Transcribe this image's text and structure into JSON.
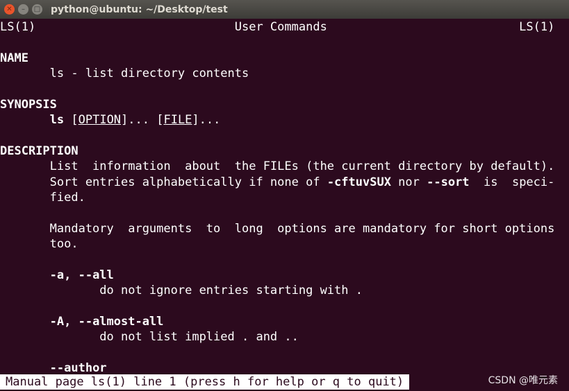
{
  "window": {
    "title": "python@ubuntu: ~/Desktop/test",
    "buttons": [
      "close",
      "minimize",
      "maximize"
    ]
  },
  "colors": {
    "terminal_bg": "#2c0a1e",
    "text": "#ffffff",
    "close_button": "#e9542b"
  },
  "man": {
    "lines": [
      [
        {
          "t": "LS(1)                            User Commands                           LS(1)"
        }
      ],
      [],
      [
        {
          "t": "NAME",
          "s": "b"
        }
      ],
      [
        {
          "t": "       ls - list directory contents"
        }
      ],
      [],
      [
        {
          "t": "SYNOPSIS",
          "s": "b"
        }
      ],
      [
        {
          "t": "       "
        },
        {
          "t": "ls",
          "s": "b"
        },
        {
          "t": " ["
        },
        {
          "t": "OPTION",
          "s": "u"
        },
        {
          "t": "]... ["
        },
        {
          "t": "FILE",
          "s": "u"
        },
        {
          "t": "]..."
        }
      ],
      [],
      [
        {
          "t": "DESCRIPTION",
          "s": "b"
        }
      ],
      [
        {
          "t": "       List  information  about  the FILEs (the current directory by default)."
        }
      ],
      [
        {
          "t": "       Sort entries alphabetically if none of "
        },
        {
          "t": "-cftuvSUX",
          "s": "b"
        },
        {
          "t": " nor "
        },
        {
          "t": "--sort",
          "s": "b"
        },
        {
          "t": "  is  speci‐"
        }
      ],
      [
        {
          "t": "       fied."
        }
      ],
      [],
      [
        {
          "t": "       Mandatory  arguments  to  long  options are mandatory for short options"
        }
      ],
      [
        {
          "t": "       too."
        }
      ],
      [],
      [
        {
          "t": "       "
        },
        {
          "t": "-a, --all",
          "s": "b"
        }
      ],
      [
        {
          "t": "              do not ignore entries starting with ."
        }
      ],
      [],
      [
        {
          "t": "       "
        },
        {
          "t": "-A, --almost-all",
          "s": "b"
        }
      ],
      [
        {
          "t": "              do not list implied . and .."
        }
      ],
      [],
      [
        {
          "t": "       "
        },
        {
          "t": "--author",
          "s": "b"
        }
      ]
    ],
    "status": "Manual page ls(1) line 1 (press h for help or q to quit)"
  },
  "watermark": "CSDN @唯元素"
}
